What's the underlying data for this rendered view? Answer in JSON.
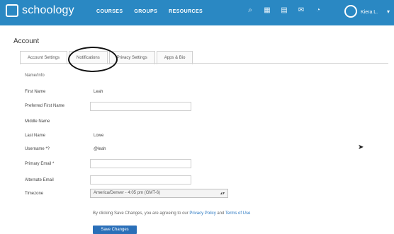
{
  "app": {
    "brand": "schoology"
  },
  "nav": [
    "COURSES",
    "GROUPS",
    "RESOURCES"
  ],
  "user": {
    "name": "Kiera L."
  },
  "page": {
    "title": "Account"
  },
  "tabs": [
    "Account Settings",
    "Notifications",
    "Privacy Settings",
    "Apps & Bio"
  ],
  "form": {
    "section_title": "Name/Info",
    "fields": [
      {
        "label": "First Name",
        "value": "Leah"
      },
      {
        "label": "Preferred First Name",
        "value": ""
      },
      {
        "label": "Middle Name",
        "value": ""
      },
      {
        "label": "Last Name",
        "value": "Lowe"
      },
      {
        "label": "Username *?",
        "value": "@leah"
      },
      {
        "label": "Primary Email *",
        "value": ""
      },
      {
        "label": "Alternate Email",
        "value": ""
      },
      {
        "label": "Timezone",
        "value": "America/Denver - 4:05 pm (GMT-6)"
      }
    ],
    "notice": {
      "before": "By clicking Save Changes, you are agreeing to our ",
      "link1": "Privacy Policy",
      "between": " and ",
      "link2": "Terms of Use"
    },
    "save_label": "Save Changes"
  },
  "colors": {
    "topbar": "#2a88c3",
    "button": "#2a6fb8",
    "link": "#2a78c2"
  },
  "icons": [
    "search-icon",
    "calendar-icon",
    "inbox-icon",
    "messages-icon",
    "notifications-icon",
    "user-avatar-icon",
    "cursor-icon"
  ]
}
